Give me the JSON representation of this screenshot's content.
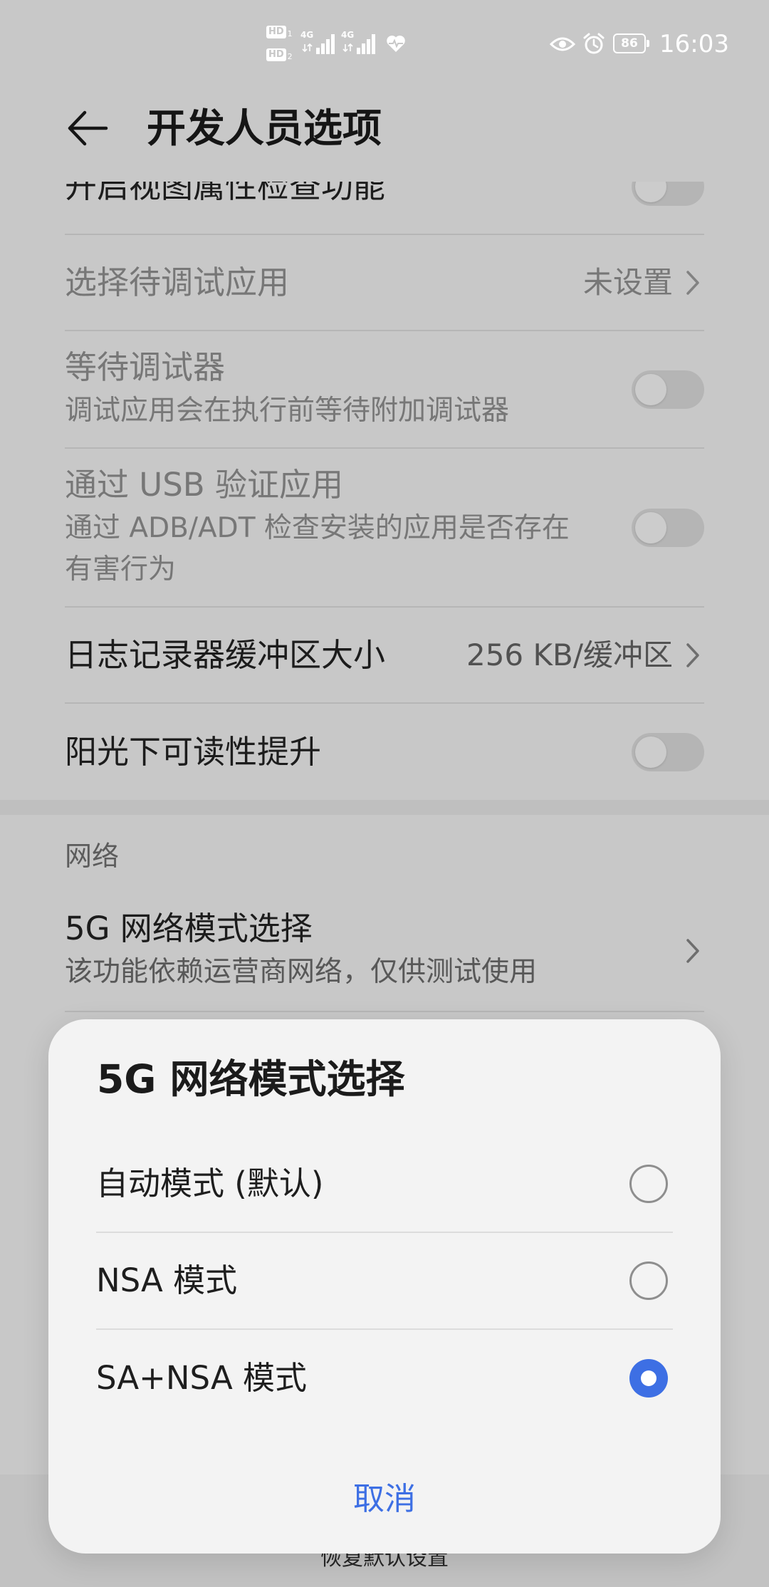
{
  "status_bar": {
    "hd1": "HD",
    "hd1_slot": "1",
    "hd2": "HD",
    "hd2_slot": "2",
    "net1": "4G",
    "net2": "4G",
    "battery": "86",
    "time": "16:03"
  },
  "header": {
    "title": "开发人员选项"
  },
  "settings": {
    "view_attr": {
      "label": "开启视图属性检查功能",
      "on": false
    },
    "debug_app": {
      "label": "选择待调试应用",
      "value": "未设置"
    },
    "wait_debugger": {
      "label": "等待调试器",
      "summary": "调试应用会在执行前等待附加调试器",
      "on": false
    },
    "verify_usb": {
      "label": "通过 USB 验证应用",
      "summary": "通过 ADB/ADT 检查安装的应用是否存在有害行为",
      "on": false
    },
    "logger_buffer": {
      "label": "日志记录器缓冲区大小",
      "value": "256 KB/缓冲区"
    },
    "sunlight": {
      "label": "阳光下可读性提升",
      "on": false
    }
  },
  "network_section": {
    "header": "网络",
    "mode_item": {
      "label": "5G 网络模式选择",
      "summary": "该功能依赖运营商网络，仅供测试使用"
    }
  },
  "footer": {
    "reset_label": "恢复默认设置"
  },
  "dialog": {
    "title": "5G 网络模式选择",
    "options": [
      {
        "label": "自动模式 (默认)",
        "selected": false
      },
      {
        "label": "NSA 模式",
        "selected": false
      },
      {
        "label": "SA+NSA 模式",
        "selected": true
      }
    ],
    "cancel_label": "取消"
  },
  "icons": {
    "back": "back-arrow-icon",
    "chevron": "chevron-right-icon",
    "signal": "signal-icon",
    "health": "heart-icon",
    "eye_comfort": "eye-icon",
    "alarm": "alarm-icon",
    "battery": "battery-icon"
  },
  "colors": {
    "accent": "#3d6fe4"
  }
}
